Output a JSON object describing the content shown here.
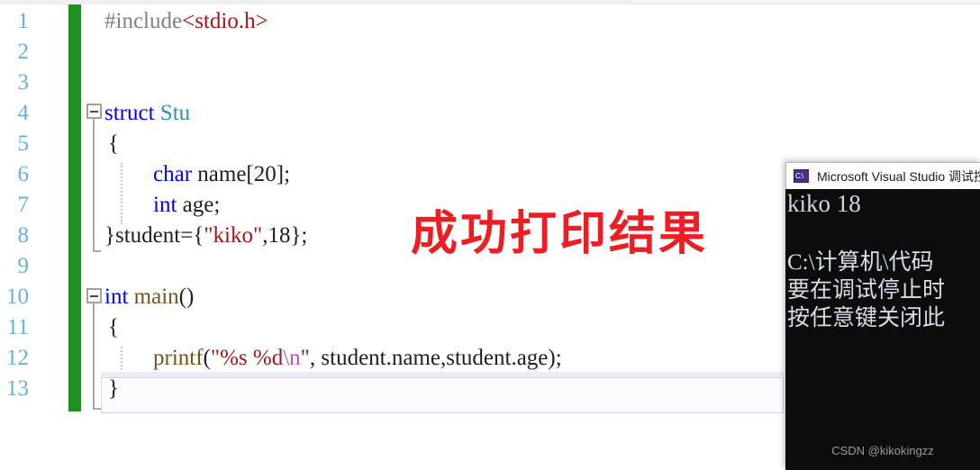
{
  "editor": {
    "line_numbers": [
      "1",
      "2",
      "3",
      "4",
      "5",
      "6",
      "7",
      "8",
      "9",
      "10",
      "11",
      "12",
      "13"
    ],
    "lines": [
      {
        "n": "1",
        "segments": [
          {
            "t": "#include",
            "c": "gray"
          },
          {
            "t": "<stdio.h>",
            "c": "str"
          }
        ]
      },
      {
        "n": "2",
        "segments": []
      },
      {
        "n": "3",
        "segments": []
      },
      {
        "n": "4",
        "segments": [
          {
            "t": "struct ",
            "c": "kw"
          },
          {
            "t": "Stu",
            "c": "type-id"
          }
        ]
      },
      {
        "n": "5",
        "segments": [
          {
            "t": "{",
            "c": "plain"
          }
        ]
      },
      {
        "n": "6",
        "segments": [
          {
            "t": "char",
            "c": "kw"
          },
          {
            "t": " name[20];",
            "c": "plain"
          }
        ]
      },
      {
        "n": "7",
        "segments": [
          {
            "t": "int",
            "c": "kw"
          },
          {
            "t": " age;",
            "c": "plain"
          }
        ]
      },
      {
        "n": "8",
        "segments": [
          {
            "t": "}student={",
            "c": "plain"
          },
          {
            "t": "\"kiko\"",
            "c": "str"
          },
          {
            "t": ",18};",
            "c": "plain"
          }
        ]
      },
      {
        "n": "9",
        "segments": []
      },
      {
        "n": "10",
        "segments": [
          {
            "t": "int ",
            "c": "kw"
          },
          {
            "t": "main",
            "c": "fn"
          },
          {
            "t": "()",
            "c": "plain"
          }
        ]
      },
      {
        "n": "11",
        "segments": [
          {
            "t": "{",
            "c": "plain"
          }
        ]
      },
      {
        "n": "12",
        "segments": [
          {
            "t": "printf",
            "c": "fn"
          },
          {
            "t": "(",
            "c": "plain"
          },
          {
            "t": "\"%s %d",
            "c": "str"
          },
          {
            "t": "\\n",
            "c": "esc"
          },
          {
            "t": "\"",
            "c": "str"
          },
          {
            "t": ", student.name,student.age);",
            "c": "plain"
          }
        ]
      },
      {
        "n": "13",
        "segments": [
          {
            "t": "}",
            "c": "plain"
          }
        ]
      }
    ],
    "line1_include": "#include",
    "line1_header": "<stdio.h>",
    "line4_kw": "struct ",
    "line4_name": "Stu",
    "line5_brace": "{",
    "line6_kw": "char",
    "line6_rest": " name[20];",
    "line7_kw": "int",
    "line7_rest": " age;",
    "line8_a": "}student={",
    "line8_str": "\"kiko\"",
    "line8_b": ",18};",
    "line10_kw": "int ",
    "line10_fn": "main",
    "line10_rest": "()",
    "line11_brace": "{",
    "line12_fn": "printf",
    "line12_open": "(",
    "line12_str1": "\"%s %d",
    "line12_esc": "\\n",
    "line12_str2": "\"",
    "line12_args": ", student.name,student.age);",
    "line13_brace": "}",
    "colors": {
      "keyword": "#0000ff",
      "type": "#2b91af",
      "string": "#a31515",
      "escape": "#b455b4",
      "function": "#74531f",
      "comment_gray": "#808080",
      "linenumber": "#6ab0de",
      "change_bar_green": "#1f9121"
    }
  },
  "annotation": {
    "text": "成功打印结果",
    "color": "#ef1c24"
  },
  "console": {
    "title": "Microsoft Visual Studio 调试控制台",
    "icon": "console-window-icon",
    "output": "kiko 18",
    "messages": [
      "C:\\计算机\\代码",
      "要在调试停止时",
      "按任意键关闭此"
    ],
    "watermark": "CSDN @kikokingzz"
  }
}
